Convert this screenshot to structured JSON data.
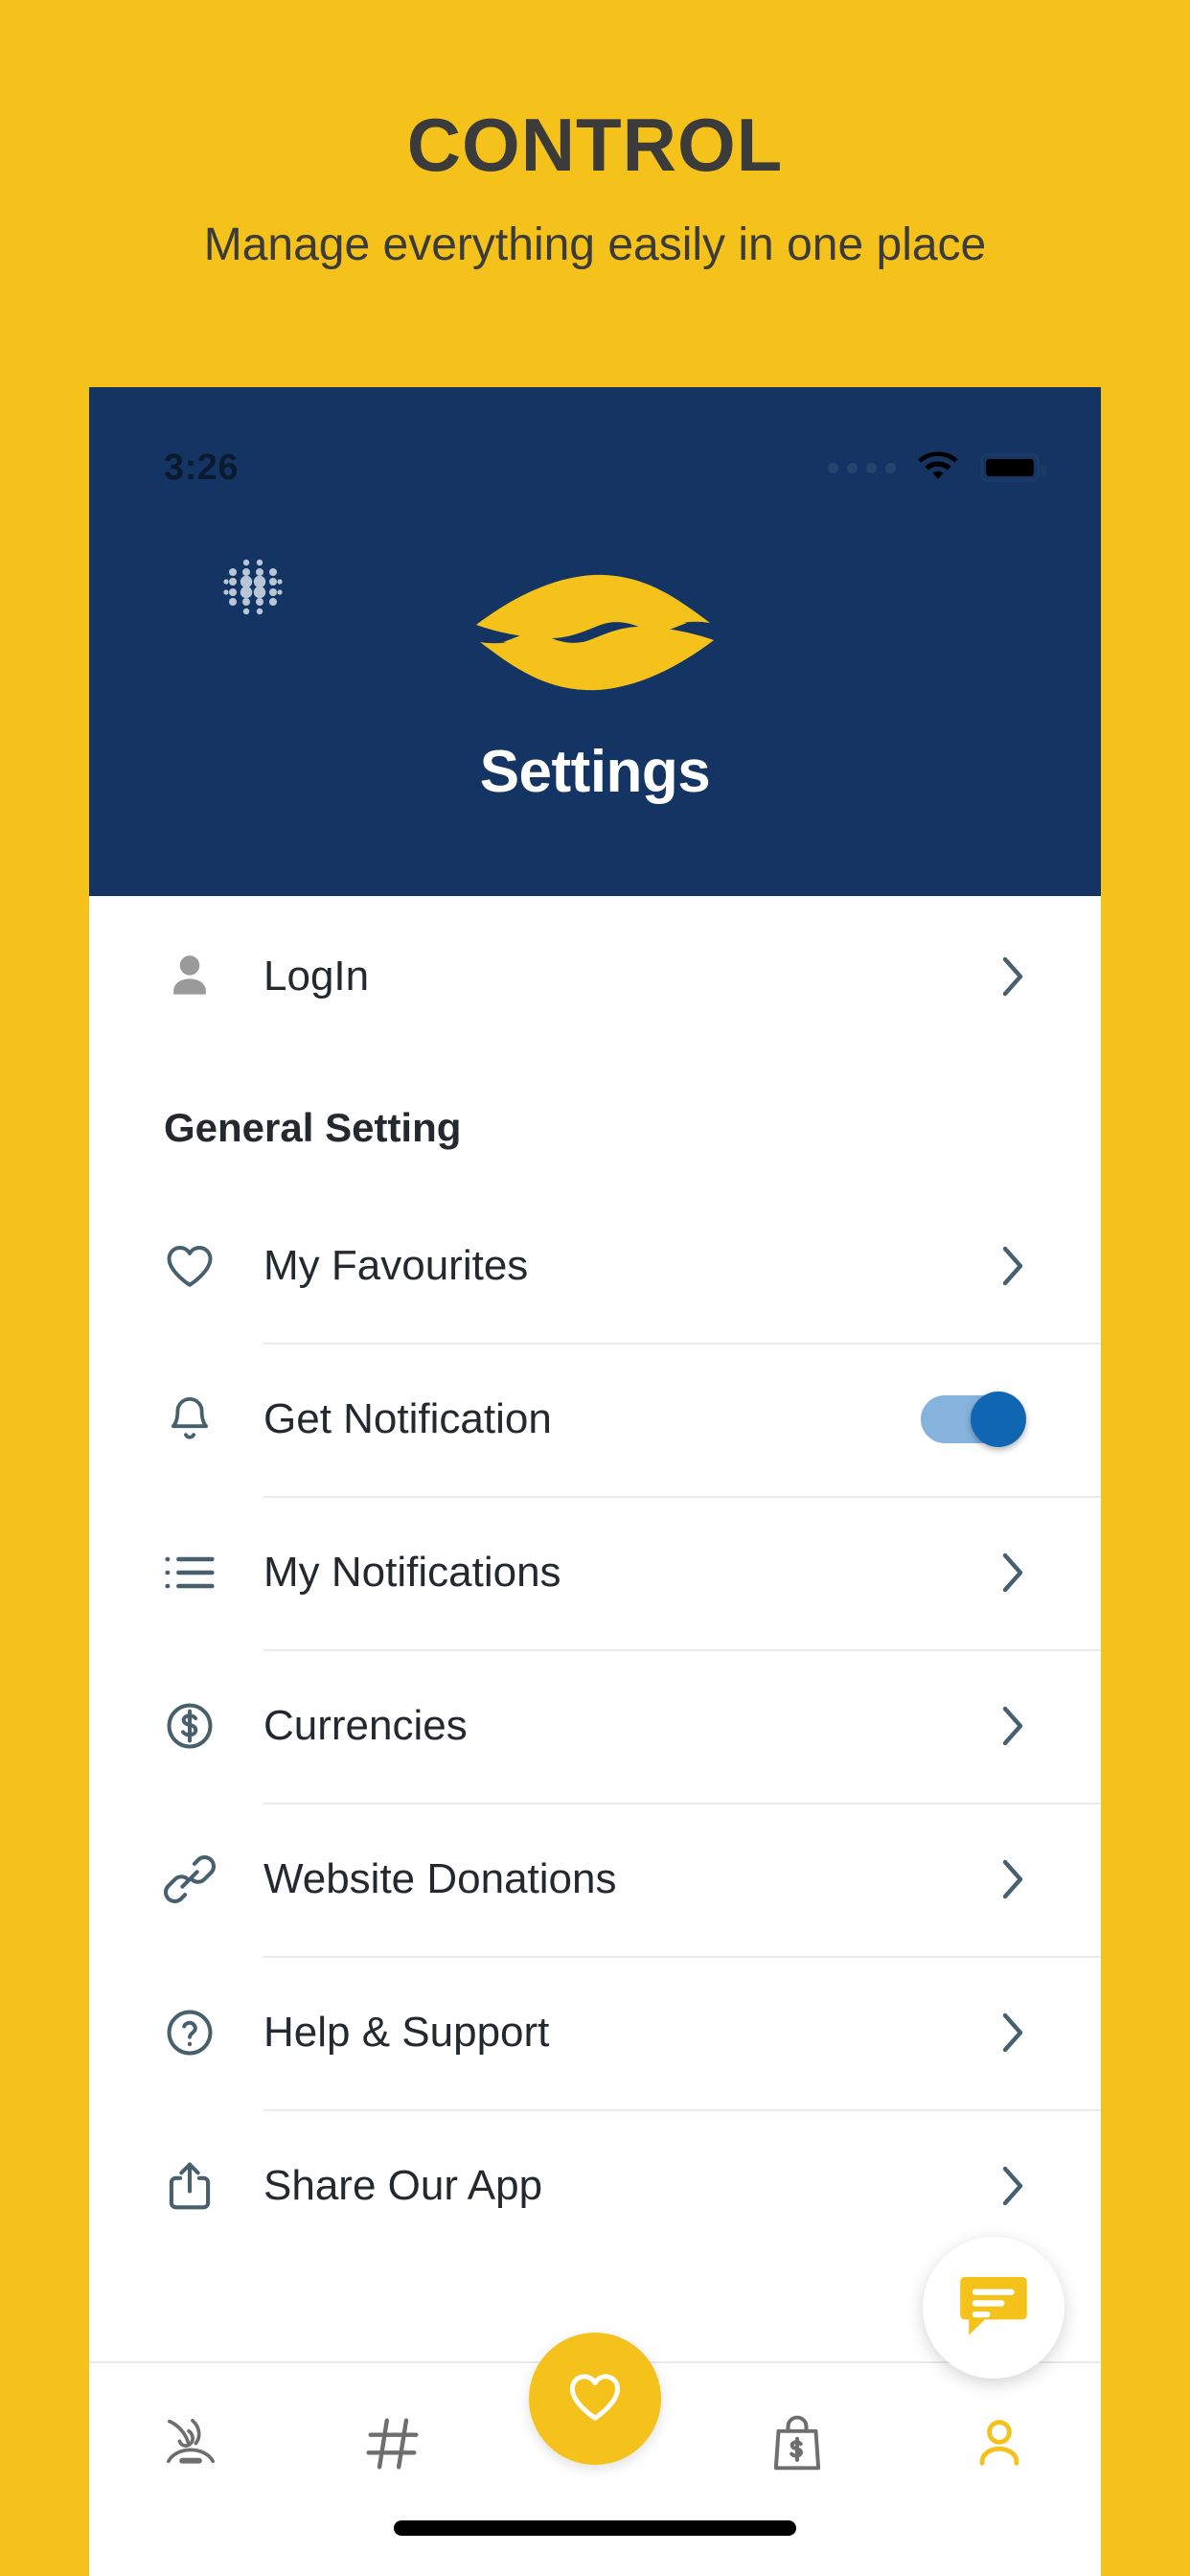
{
  "promo": {
    "title": "CONTROL",
    "subtitle": "Manage everything easily in one place"
  },
  "colors": {
    "brand_yellow": "#f5c21b",
    "header_navy": "#143563",
    "toggle_on": "#1166b3",
    "toggle_track": "#86b3de",
    "text_dark": "#23292e",
    "divider": "#e9eaec"
  },
  "phone": {
    "statusbar": {
      "time": "3:26",
      "signal_icon": "signal-dots-icon",
      "wifi_icon": "wifi-icon",
      "battery_icon": "battery-full-icon"
    },
    "header": {
      "menu_icon": "dot-grid-icon",
      "logo_icon": "helping-hands-logo-icon",
      "title": "Settings"
    },
    "login": {
      "icon": "person-icon",
      "label": "LogIn",
      "chevron_icon": "chevron-right-icon"
    },
    "section": {
      "title": "General Setting"
    },
    "settings": [
      {
        "icon": "heart-icon",
        "label": "My Favourites",
        "control": "chevron",
        "chevron_icon": "chevron-right-icon"
      },
      {
        "icon": "bell-icon",
        "label": "Get Notification",
        "control": "toggle",
        "toggle_state": "on"
      },
      {
        "icon": "list-icon",
        "label": "My Notifications",
        "control": "chevron",
        "chevron_icon": "chevron-right-icon"
      },
      {
        "icon": "dollar-circle-icon",
        "label": "Currencies",
        "control": "chevron",
        "chevron_icon": "chevron-right-icon"
      },
      {
        "icon": "link-icon",
        "label": "Website Donations",
        "control": "chevron",
        "chevron_icon": "chevron-right-icon"
      },
      {
        "icon": "question-circle-icon",
        "label": "Help & Support",
        "control": "chevron",
        "chevron_icon": "chevron-right-icon"
      },
      {
        "icon": "share-icon",
        "label": "Share Our App",
        "control": "chevron",
        "chevron_icon": "chevron-right-icon"
      }
    ],
    "fab": {
      "icon": "heart-outline-icon"
    },
    "chat_button": {
      "icon": "chat-bubble-icon"
    },
    "bottom_nav": [
      {
        "icon": "helping-hands-outline-icon",
        "active": false
      },
      {
        "icon": "hashtag-icon",
        "active": false
      },
      {
        "icon": "fab-placeholder",
        "active": false
      },
      {
        "icon": "shopping-bag-dollar-icon",
        "active": false
      },
      {
        "icon": "person-outline-icon",
        "active": true
      }
    ],
    "home_indicator": "home-indicator-bar"
  }
}
